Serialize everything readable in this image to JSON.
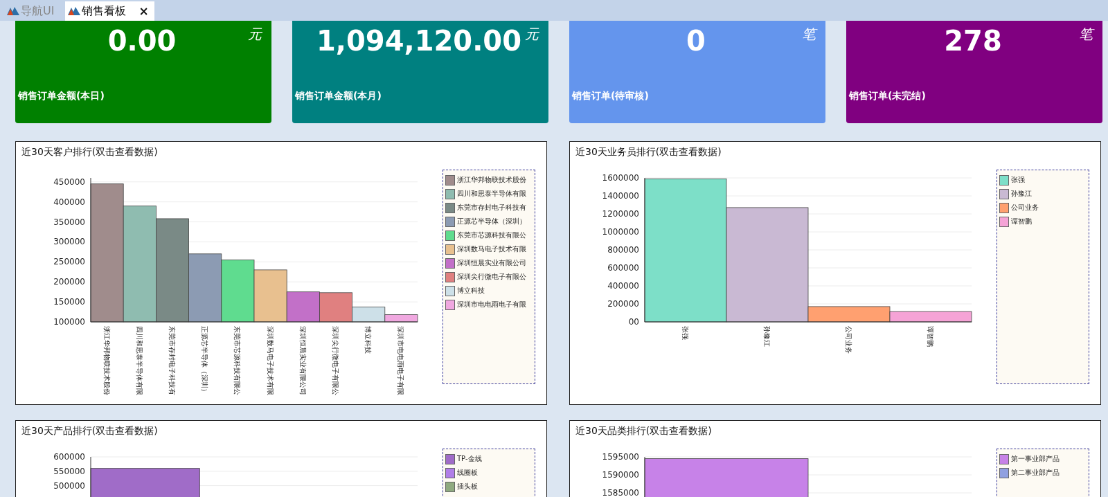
{
  "tabs": [
    {
      "label": "导航UI",
      "selected": false
    },
    {
      "label": "销售看板",
      "selected": true,
      "close": "×"
    }
  ],
  "cards": [
    {
      "value": "0.00",
      "unit": "元",
      "label": "销售订单金额(本日)",
      "color": "#008000"
    },
    {
      "value": "1,094,120.00",
      "unit": "元",
      "label": "销售订单金额(本月)",
      "color": "#008080"
    },
    {
      "value": "0",
      "unit": "笔",
      "label": "销售订单(待审核)",
      "color": "#6495ed"
    },
    {
      "value": "278",
      "unit": "笔",
      "label": "销售订单(未完结)",
      "color": "#800080"
    }
  ],
  "charts": [
    {
      "title": "近30天客户排行(双击查看数据)",
      "chart_data": {
        "type": "bar",
        "categories": [
          "浙江华邦物联技术股份",
          "四川和思泰半导体有限",
          "东莞市存封电子科技有",
          "正源芯半导体（深圳）",
          "东莞市芯源科技有限公",
          "深圳数马电子技术有限",
          "深圳恒晨实业有限公司",
          "深圳尖行微电子有限公",
          "博立科技",
          "深圳市电电雨电子有限"
        ],
        "values": [
          445000,
          390000,
          358000,
          270000,
          255000,
          230000,
          175000,
          173000,
          137000,
          118000
        ],
        "grid": true,
        "ylim": [
          100000,
          460000
        ],
        "yticks": [
          100000,
          150000,
          200000,
          250000,
          300000,
          350000,
          400000,
          450000
        ]
      },
      "legend": [
        {
          "label": "浙江华邦物联技术股份",
          "color": "#a08c8c"
        },
        {
          "label": "四川和思泰半导体有限",
          "color": "#8fbcb0"
        },
        {
          "label": "东莞市存封电子科技有",
          "color": "#7a8a86"
        },
        {
          "label": "正源芯半导体（深圳）",
          "color": "#8c9bb3"
        },
        {
          "label": "东莞市芯源科技有限公",
          "color": "#5fdc8f"
        },
        {
          "label": "深圳数马电子技术有限",
          "color": "#e8c08f"
        },
        {
          "label": "深圳恒晨实业有限公司",
          "color": "#c270c8"
        },
        {
          "label": "深圳尖行微电子有限公",
          "color": "#e08080"
        },
        {
          "label": "博立科技",
          "color": "#cde0e8"
        },
        {
          "label": "深圳市电电雨电子有限",
          "color": "#f0a8e0"
        }
      ]
    },
    {
      "title": "近30天业务员排行(双击查看数据)",
      "chart_data": {
        "type": "bar",
        "categories": [
          "张强",
          "孙豫江",
          "公司业务",
          "谭智鹏"
        ],
        "values": [
          1590000,
          1270000,
          170000,
          115000
        ],
        "grid": true,
        "ylim": [
          0,
          1600000
        ],
        "yticks": [
          {
            "value": 0,
            "label": "00"
          },
          200000,
          400000,
          600000,
          800000,
          1000000,
          1200000,
          1400000,
          1600000
        ]
      },
      "legend": [
        {
          "label": "张强",
          "color": "#7ddfc8"
        },
        {
          "label": "孙豫江",
          "color": "#c9b9d3"
        },
        {
          "label": "公司业务",
          "color": "#ffa070"
        },
        {
          "label": "谭智鹏",
          "color": "#f5a3d6"
        }
      ]
    },
    {
      "title": "近30天产品排行(双击查看数据)",
      "chart_data": {
        "type": "bar",
        "values": [
          560000,
          null,
          null
        ],
        "grid": true,
        "ylim": [
          100000,
          600000
        ],
        "yticks": [
          500000,
          550000,
          600000
        ]
      },
      "legend": [
        {
          "label": "TP-金线",
          "color": "#a06cc8"
        },
        {
          "label": "线圈板",
          "color": "#b07ee8"
        },
        {
          "label": "插头板",
          "color": "#8faa80"
        }
      ]
    },
    {
      "title": "近30天品类排行(双击查看数据)",
      "chart_data": {
        "type": "bar",
        "values": [
          1594500,
          null
        ],
        "grid": true,
        "ylim": [
          1555000,
          1595000
        ],
        "yticks": [
          1585000,
          1590000,
          1595000
        ]
      },
      "legend": [
        {
          "label": "第一事业部产品",
          "color": "#c782e8"
        },
        {
          "label": "第二事业部产品",
          "color": "#90a0e0"
        }
      ]
    }
  ]
}
